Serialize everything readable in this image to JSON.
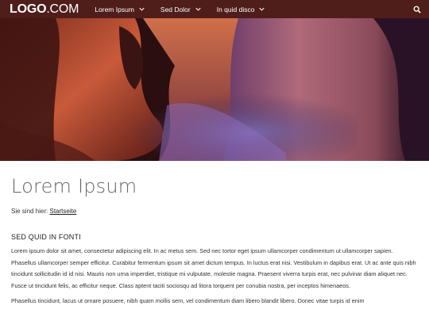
{
  "header": {
    "logo_bold": "LOGO",
    "logo_light": ".COM",
    "nav": [
      {
        "label": "Lorem Ipsum"
      },
      {
        "label": "Sed Dolor"
      },
      {
        "label": "In quid disco"
      }
    ]
  },
  "page": {
    "title": "Lorem Ipsum",
    "breadcrumb_prefix": "Sie sind hier:",
    "breadcrumb_link": "Startseite",
    "section_title": "SED QUID IN FONTI",
    "paragraphs": [
      "Lorem ipsum dolor sit amet, consectetur adipiscing elit. In ac metus sem. Sed nec tortor eget ipsum ullamcorper condimentum ut ullamcorper sapien. Phasellus ullamcorper semper efficitur. Curabitur fermentum ipsum sit amet dictum tempus. In luctus erat nisi. Vestibulum in dapibus erat. Ut ac ante quis nibh tincidunt sollicitudin id id nisi. Mauris non urna imperdiet, tristique mi vulputate, molestie magna. Praesent viverra turpis erat, nec pulvinar diam aliquet nec. Fusce ut tincidunt felis, ac efficitur neque. Class aptent taciti sociosqu ad litora torquent per conubia nostra, per inceptos himenaeos.",
      "Phasellus tincidunt, lacus ut ornare posuere, nibh quam mollis sem, vel condimentum diam libero blandit libero. Donec vitae turpis id enim"
    ]
  },
  "colors": {
    "topbar": "#4f1d1a",
    "title": "#666666",
    "body_text": "#333333"
  },
  "icons": {
    "search": "search-icon",
    "dropdown": "chevron-down-icon"
  }
}
